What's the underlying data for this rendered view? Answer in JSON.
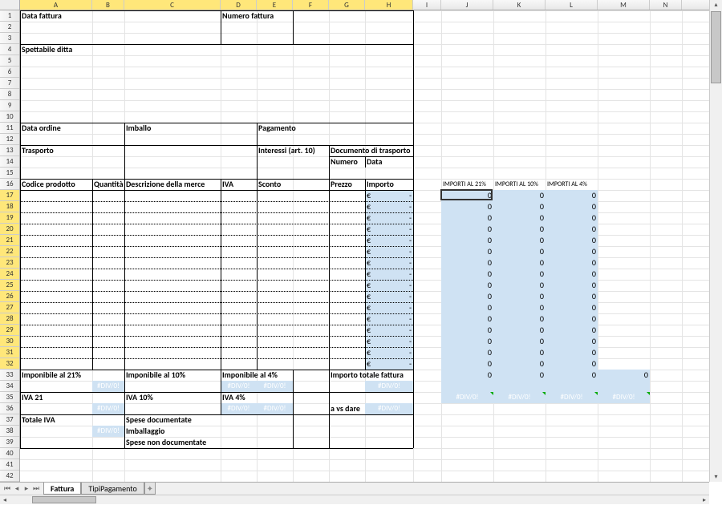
{
  "columns": [
    {
      "l": "A",
      "w": 90,
      "sel": true
    },
    {
      "l": "B",
      "w": 40,
      "sel": true
    },
    {
      "l": "C",
      "w": 120,
      "sel": true
    },
    {
      "l": "D",
      "w": 45,
      "sel": true
    },
    {
      "l": "E",
      "w": 45,
      "sel": true
    },
    {
      "l": "F",
      "w": 45,
      "sel": true
    },
    {
      "l": "G",
      "w": 45,
      "sel": true
    },
    {
      "l": "H",
      "w": 60,
      "sel": true
    },
    {
      "l": "I",
      "w": 35,
      "sel": false
    },
    {
      "l": "J",
      "w": 65,
      "sel": false
    },
    {
      "l": "K",
      "w": 65,
      "sel": false
    },
    {
      "l": "L",
      "w": 65,
      "sel": false
    },
    {
      "l": "M",
      "w": 65,
      "sel": false
    },
    {
      "l": "N",
      "w": 40,
      "sel": false
    }
  ],
  "rowCount": 43,
  "selRowsFrom": 17,
  "selRowsTo": 32,
  "labels": {
    "data_fattura": "Data fattura",
    "numero_fattura": "Numero fattura",
    "spettabile": "Spettabile ditta",
    "data_ordine": "Data ordine",
    "imballo": "Imballo",
    "pagamento": "Pagamento",
    "trasporto": "Trasporto",
    "interessi": "Interessi (art. 10)",
    "doc_trasporto": "Documento di trasporto",
    "numero": "Numero",
    "data": "Data",
    "codice": "Codice prodotto",
    "quantita": "Quantità",
    "descrizione": "Descrizione della merce",
    "iva": "IVA",
    "sconto": "Sconto",
    "prezzo": "Prezzo",
    "importo": "Importo",
    "imp21": "Imponibile al 21%",
    "imp10": "Imponibile al 10%",
    "imp4": "Imponibile al 4%",
    "iva21": "IVA 21",
    "iva10": "IVA 10%",
    "iva4": "IVA 4%",
    "totale_iva": "Totale IVA",
    "spese_doc": "Spese documentate",
    "imballaggio": "Imballaggio",
    "spese_non_doc": "Spese non documentate",
    "importo_totale": "Importo totale fattura",
    "a_vs_dare": "a vs dare",
    "importi21": "IMPORTI AL 21%",
    "importi10": "IMPORTI AL 10%",
    "importi4": "IMPORTI AL 4%",
    "euro": "€",
    "dash": "-",
    "zero": "0",
    "div0": "#DIV/0!"
  },
  "itemRows": 16,
  "tabs": {
    "active": "Fattura",
    "other": "TipiPagamento"
  },
  "selectedCell": "J17"
}
